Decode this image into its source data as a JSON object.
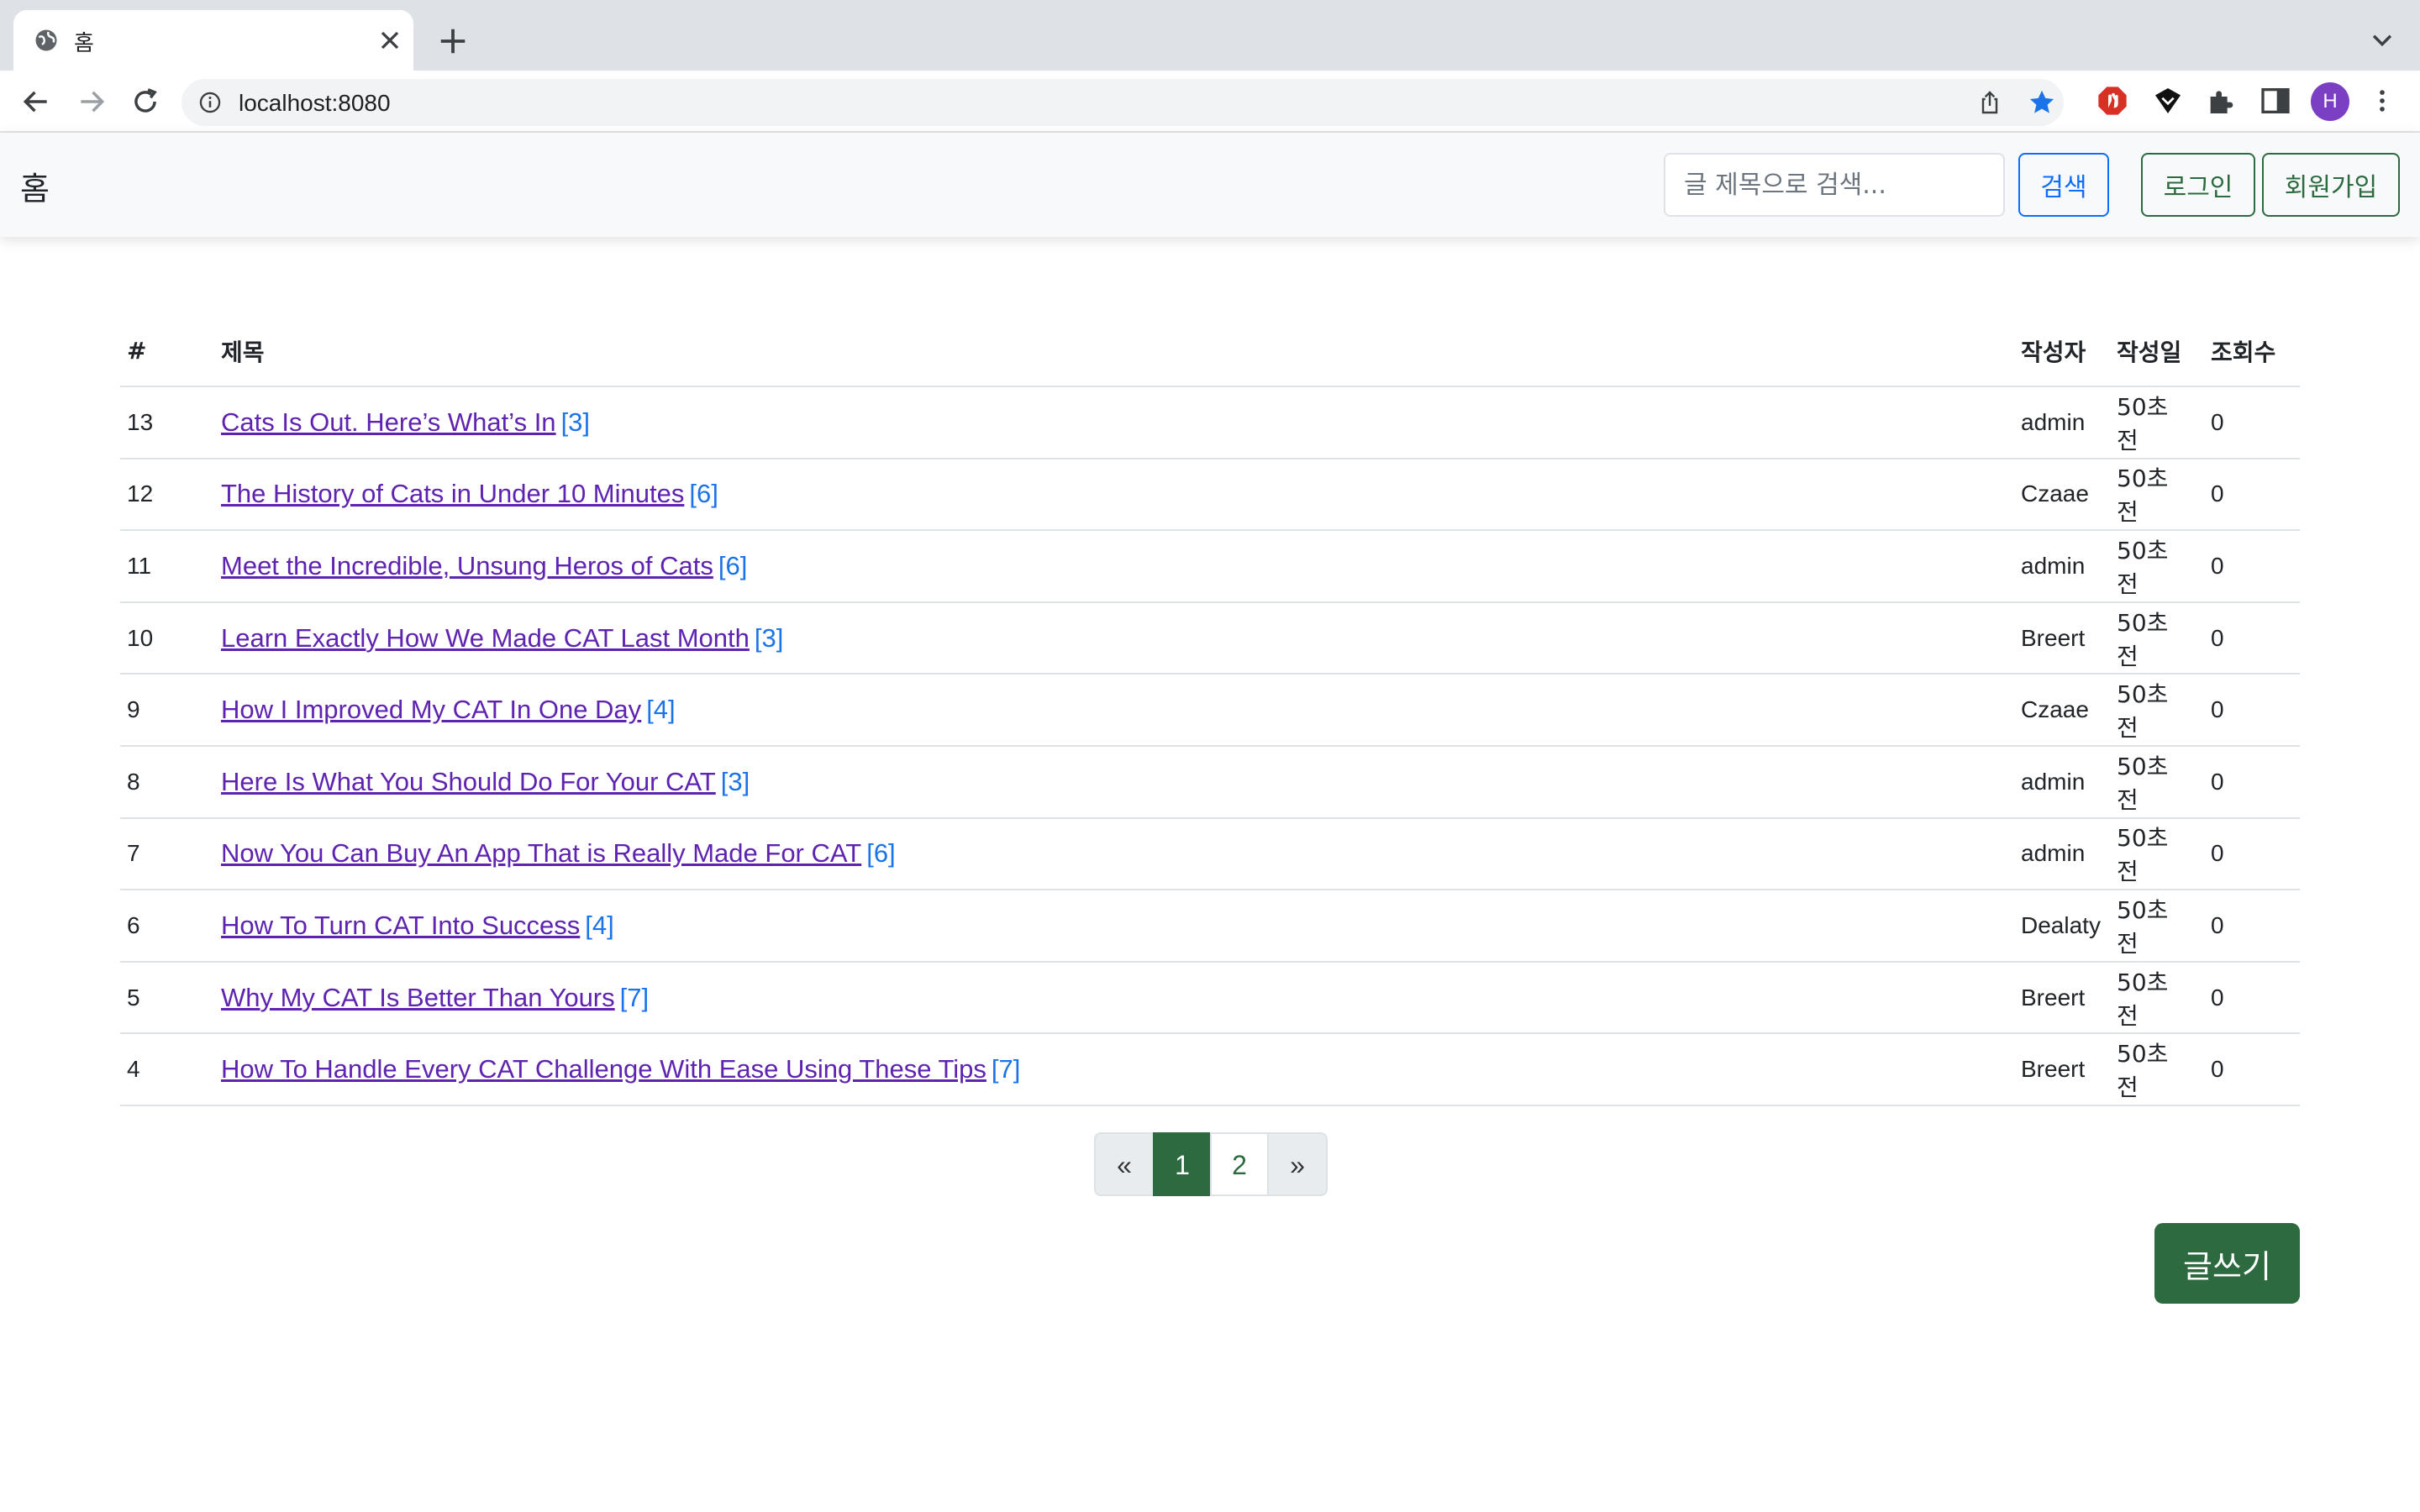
{
  "browser": {
    "tab_title": "홈",
    "url": "localhost:8080",
    "profile_initial": "H"
  },
  "navbar": {
    "brand": "홈",
    "search_placeholder": "글 제목으로 검색...",
    "search_button": "검색",
    "login_button": "로그인",
    "signup_button": "회원가입"
  },
  "table": {
    "headers": {
      "num": "#",
      "title": "제목",
      "author": "작성자",
      "date": "작성일",
      "views": "조회수"
    },
    "rows": [
      {
        "num": "13",
        "title": "Cats Is Out. Here’s What’s In",
        "comments": "[3]",
        "author": "admin",
        "date": "50초 전",
        "views": "0"
      },
      {
        "num": "12",
        "title": "The History of Cats in Under 10 Minutes",
        "comments": "[6]",
        "author": "Czaae",
        "date": "50초 전",
        "views": "0"
      },
      {
        "num": "11",
        "title": "Meet the Incredible, Unsung Heros of Cats",
        "comments": "[6]",
        "author": "admin",
        "date": "50초 전",
        "views": "0"
      },
      {
        "num": "10",
        "title": "Learn Exactly How We Made CAT Last Month",
        "comments": "[3]",
        "author": "Breert",
        "date": "50초 전",
        "views": "0"
      },
      {
        "num": "9",
        "title": "How I Improved My CAT In One Day",
        "comments": "[4]",
        "author": "Czaae",
        "date": "50초 전",
        "views": "0"
      },
      {
        "num": "8",
        "title": "Here Is What You Should Do For Your CAT",
        "comments": "[3]",
        "author": "admin",
        "date": "50초 전",
        "views": "0"
      },
      {
        "num": "7",
        "title": "Now You Can Buy An App That is Really Made For CAT",
        "comments": "[6]",
        "author": "admin",
        "date": "50초 전",
        "views": "0"
      },
      {
        "num": "6",
        "title": "How To Turn CAT Into Success",
        "comments": "[4]",
        "author": "Dealaty",
        "date": "50초 전",
        "views": "0"
      },
      {
        "num": "5",
        "title": "Why My CAT Is Better Than Yours",
        "comments": "[7]",
        "author": "Breert",
        "date": "50초 전",
        "views": "0"
      },
      {
        "num": "4",
        "title": "How To Handle Every CAT Challenge With Ease Using These Tips",
        "comments": "[7]",
        "author": "Breert",
        "date": "50초 전",
        "views": "0"
      }
    ]
  },
  "pagination": {
    "prev": "«",
    "pages": [
      "1",
      "2"
    ],
    "active": "1",
    "next": "»"
  },
  "write_button": "글쓰기",
  "colors": {
    "primary": "#2d6a3f",
    "search_blue": "#0d6efd",
    "link_visited": "#5e23b0",
    "comment_count": "#1a73e8"
  }
}
